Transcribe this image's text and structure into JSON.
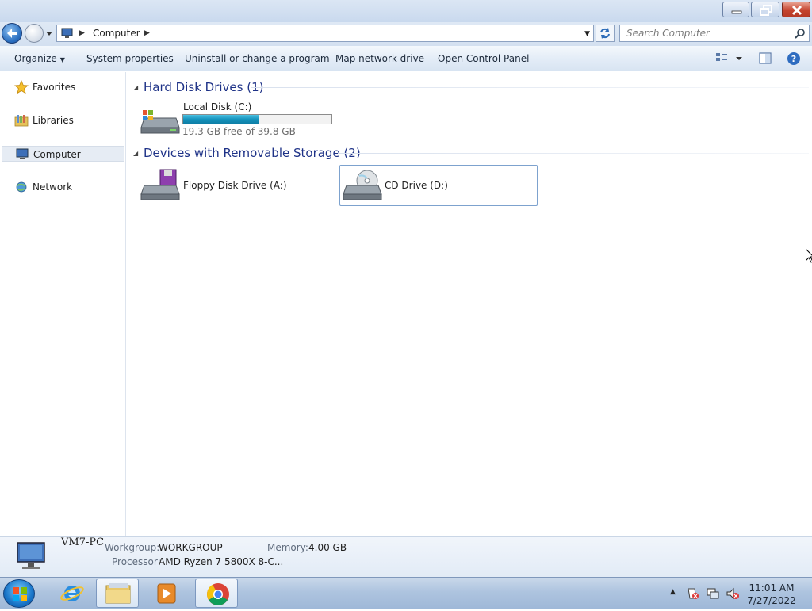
{
  "window": {
    "minimize_icon": "minimize-icon",
    "maximize_icon": "restore-icon",
    "close_icon": "close-icon"
  },
  "address": {
    "breadcrumb": [
      "Computer"
    ],
    "search_placeholder": "Search Computer"
  },
  "toolbar": {
    "organize": "Organize",
    "system_properties": "System properties",
    "uninstall": "Uninstall or change a program",
    "map_drive": "Map network drive",
    "control_panel": "Open Control Panel"
  },
  "nav": {
    "items": [
      {
        "label": "Favorites",
        "icon": "star-icon"
      },
      {
        "label": "Libraries",
        "icon": "library-icon"
      },
      {
        "label": "Computer",
        "icon": "computer-icon",
        "selected": true
      },
      {
        "label": "Network",
        "icon": "network-icon"
      }
    ]
  },
  "groups": {
    "hard_disks": {
      "title": "Hard Disk Drives (1)",
      "items": [
        {
          "label": "Local Disk (C:)",
          "free_text": "19.3 GB free of 39.8 GB",
          "used_fraction": 0.515
        }
      ]
    },
    "removable": {
      "title": "Devices with Removable Storage (2)",
      "items": [
        {
          "label": "Floppy Disk Drive (A:)"
        },
        {
          "label": "CD Drive (D:)"
        }
      ]
    }
  },
  "details": {
    "computer_name": "VM7-PC",
    "workgroup_label": "Workgroup:",
    "workgroup_value": "WORKGROUP",
    "memory_label": "Memory:",
    "memory_value": "4.00 GB",
    "processor_label": "Processor:",
    "processor_value": "AMD Ryzen 7 5800X 8-C..."
  },
  "taskbar": {
    "time": "11:01 AM",
    "date": "7/27/2022"
  },
  "colors": {
    "group_title": "#1e3287",
    "progress_fill": "#1593bd",
    "close_button": "#c5442f"
  }
}
